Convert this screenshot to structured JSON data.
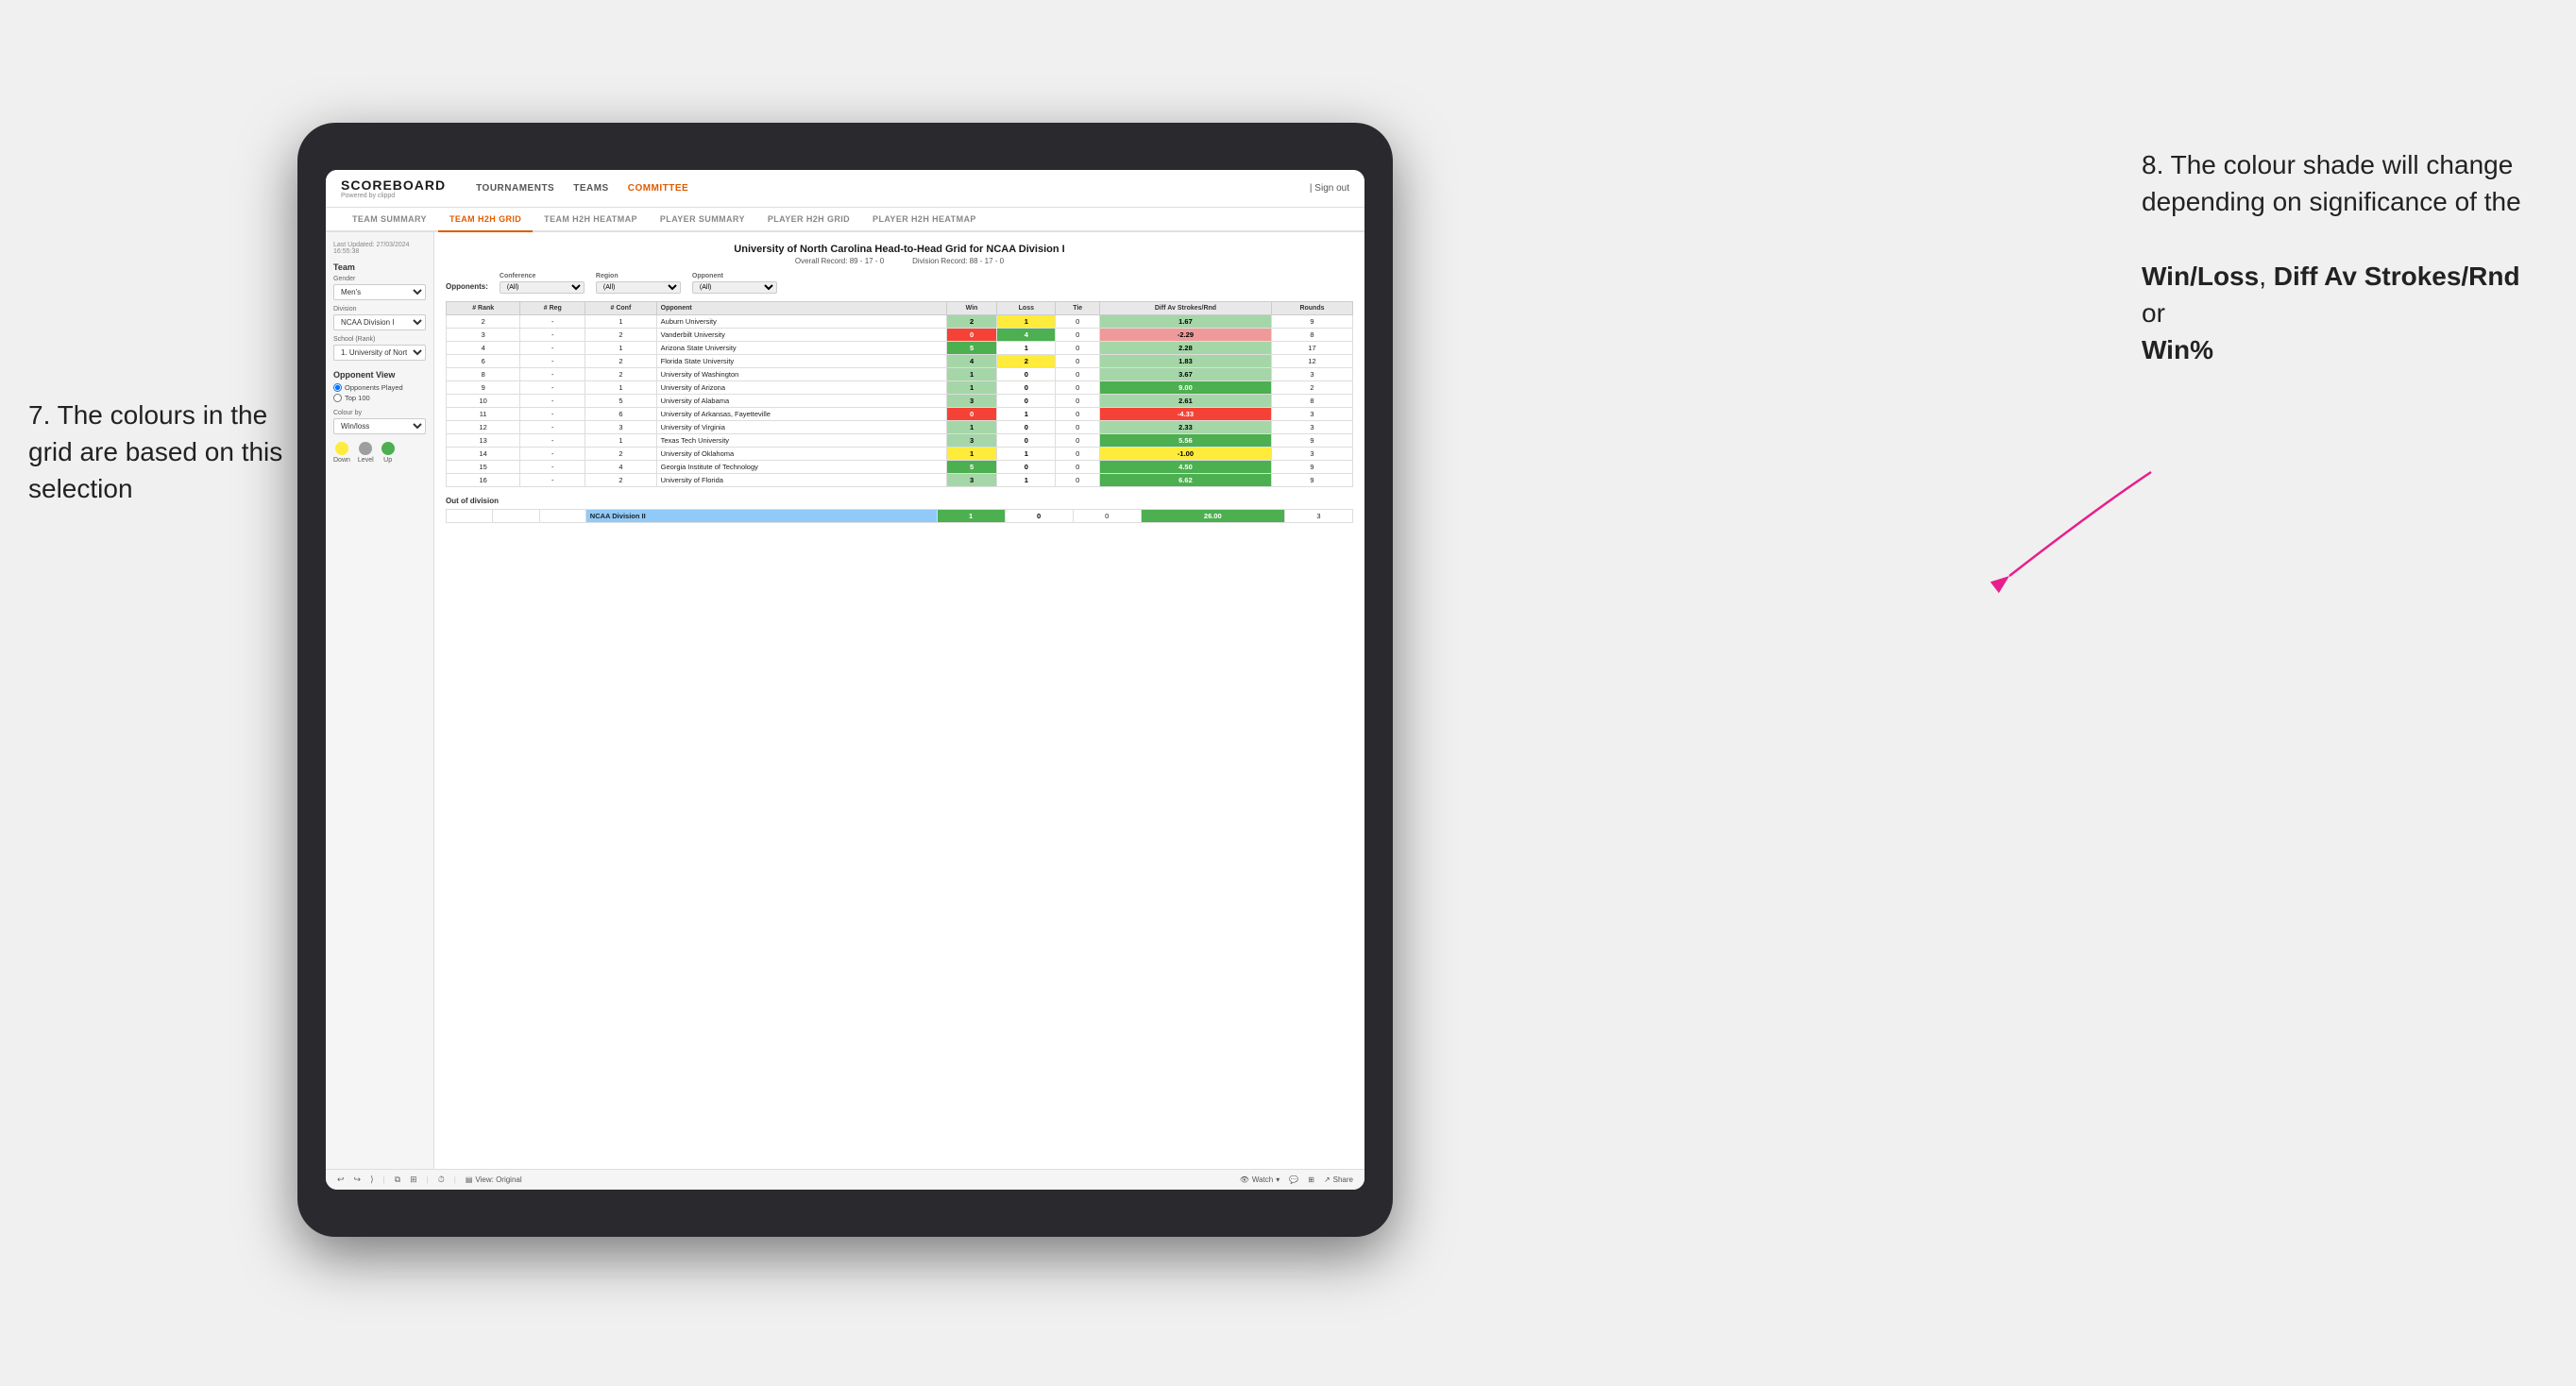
{
  "annotations": {
    "left_title": "7. The colours in the grid are based on this selection",
    "right_title": "8. The colour shade will change depending on significance of the",
    "right_bold1": "Win/Loss",
    "right_comma": ", ",
    "right_bold2": "Diff Av Strokes/Rnd",
    "right_or": " or",
    "right_bold3": "Win%"
  },
  "nav": {
    "brand": "SCOREBOARD",
    "brand_sub": "Powered by clippd",
    "items": [
      "TOURNAMENTS",
      "TEAMS",
      "COMMITTEE"
    ],
    "active": "COMMITTEE",
    "sign_out": "Sign out"
  },
  "sub_nav": {
    "items": [
      "TEAM SUMMARY",
      "TEAM H2H GRID",
      "TEAM H2H HEATMAP",
      "PLAYER SUMMARY",
      "PLAYER H2H GRID",
      "PLAYER H2H HEATMAP"
    ],
    "active": "TEAM H2H GRID"
  },
  "left_panel": {
    "last_updated_label": "Last Updated: 27/03/2024",
    "last_updated_time": "16:55:38",
    "team_label": "Team",
    "gender_label": "Gender",
    "gender_value": "Men's",
    "division_label": "Division",
    "division_value": "NCAA Division I",
    "school_label": "School (Rank)",
    "school_value": "1. University of Nort...",
    "opponent_view_label": "Opponent View",
    "radio1": "Opponents Played",
    "radio2": "Top 100",
    "colour_by_label": "Colour by",
    "colour_by_value": "Win/loss",
    "legend_down": "Down",
    "legend_level": "Level",
    "legend_up": "Up"
  },
  "grid": {
    "title": "University of North Carolina Head-to-Head Grid for NCAA Division I",
    "overall_record": "Overall Record: 89 - 17 - 0",
    "division_record": "Division Record: 88 - 17 - 0",
    "filters": {
      "opponents_label": "Opponents:",
      "conference_label": "Conference",
      "conference_value": "(All)",
      "region_label": "Region",
      "region_value": "(All)",
      "opponent_label": "Opponent",
      "opponent_value": "(All)"
    },
    "columns": [
      "#\nRank",
      "#\nReg",
      "#\nConf",
      "Opponent",
      "Win",
      "Loss",
      "Tie",
      "Diff Av\nStrokes/Rnd",
      "Rounds"
    ],
    "rows": [
      {
        "rank": "2",
        "reg": "-",
        "conf": "1",
        "opponent": "Auburn University",
        "win": "2",
        "loss": "1",
        "tie": "0",
        "diff": "1.67",
        "rounds": "9",
        "win_color": "green_light",
        "loss_color": "yellow",
        "diff_color": "green_light"
      },
      {
        "rank": "3",
        "reg": "-",
        "conf": "2",
        "opponent": "Vanderbilt University",
        "win": "0",
        "loss": "4",
        "tie": "0",
        "diff": "-2.29",
        "rounds": "8",
        "win_color": "red_dark",
        "loss_color": "green_dark",
        "diff_color": "red_light"
      },
      {
        "rank": "4",
        "reg": "-",
        "conf": "1",
        "opponent": "Arizona State University",
        "win": "5",
        "loss": "1",
        "tie": "0",
        "diff": "2.28",
        "rounds": "17",
        "win_color": "green_dark",
        "loss_color": "neutral",
        "diff_color": "green_light"
      },
      {
        "rank": "6",
        "reg": "-",
        "conf": "2",
        "opponent": "Florida State University",
        "win": "4",
        "loss": "2",
        "tie": "0",
        "diff": "1.83",
        "rounds": "12",
        "win_color": "green_light",
        "loss_color": "yellow",
        "diff_color": "green_light"
      },
      {
        "rank": "8",
        "reg": "-",
        "conf": "2",
        "opponent": "University of Washington",
        "win": "1",
        "loss": "0",
        "tie": "0",
        "diff": "3.67",
        "rounds": "3",
        "win_color": "green_light",
        "loss_color": "neutral",
        "diff_color": "green_light"
      },
      {
        "rank": "9",
        "reg": "-",
        "conf": "1",
        "opponent": "University of Arizona",
        "win": "1",
        "loss": "0",
        "tie": "0",
        "diff": "9.00",
        "rounds": "2",
        "win_color": "green_light",
        "loss_color": "neutral",
        "diff_color": "green_dark"
      },
      {
        "rank": "10",
        "reg": "-",
        "conf": "5",
        "opponent": "University of Alabama",
        "win": "3",
        "loss": "0",
        "tie": "0",
        "diff": "2.61",
        "rounds": "8",
        "win_color": "green_light",
        "loss_color": "neutral",
        "diff_color": "green_light"
      },
      {
        "rank": "11",
        "reg": "-",
        "conf": "6",
        "opponent": "University of Arkansas, Fayetteville",
        "win": "0",
        "loss": "1",
        "tie": "0",
        "diff": "-4.33",
        "rounds": "3",
        "win_color": "red_dark",
        "loss_color": "neutral",
        "diff_color": "red_dark"
      },
      {
        "rank": "12",
        "reg": "-",
        "conf": "3",
        "opponent": "University of Virginia",
        "win": "1",
        "loss": "0",
        "tie": "0",
        "diff": "2.33",
        "rounds": "3",
        "win_color": "green_light",
        "loss_color": "neutral",
        "diff_color": "green_light"
      },
      {
        "rank": "13",
        "reg": "-",
        "conf": "1",
        "opponent": "Texas Tech University",
        "win": "3",
        "loss": "0",
        "tie": "0",
        "diff": "5.56",
        "rounds": "9",
        "win_color": "green_light",
        "loss_color": "neutral",
        "diff_color": "green_dark"
      },
      {
        "rank": "14",
        "reg": "-",
        "conf": "2",
        "opponent": "University of Oklahoma",
        "win": "1",
        "loss": "1",
        "tie": "0",
        "diff": "-1.00",
        "rounds": "3",
        "win_color": "yellow",
        "loss_color": "neutral",
        "diff_color": "yellow"
      },
      {
        "rank": "15",
        "reg": "-",
        "conf": "4",
        "opponent": "Georgia Institute of Technology",
        "win": "5",
        "loss": "0",
        "tie": "0",
        "diff": "4.50",
        "rounds": "9",
        "win_color": "green_dark",
        "loss_color": "neutral",
        "diff_color": "green_dark"
      },
      {
        "rank": "16",
        "reg": "-",
        "conf": "2",
        "opponent": "University of Florida",
        "win": "3",
        "loss": "1",
        "tie": "0",
        "diff": "6.62",
        "rounds": "9",
        "win_color": "green_light",
        "loss_color": "neutral",
        "diff_color": "green_dark"
      }
    ],
    "out_of_division_label": "Out of division",
    "out_of_division_rows": [
      {
        "division": "NCAA Division II",
        "win": "1",
        "loss": "0",
        "tie": "0",
        "diff": "26.00",
        "rounds": "3",
        "win_color": "green_dark",
        "loss_color": "neutral",
        "diff_color": "green_dark"
      }
    ]
  },
  "toolbar": {
    "view_label": "View: Original",
    "watch_label": "Watch",
    "share_label": "Share"
  }
}
